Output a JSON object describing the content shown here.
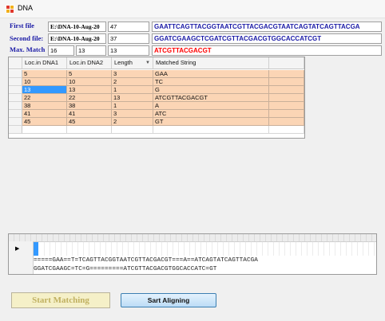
{
  "window": {
    "title": "DNA"
  },
  "inputs": {
    "first_label": "First file",
    "second_label": "Second file:",
    "max_label": "Max. Match",
    "first_path": "E:\\DNA-10-Aug-20",
    "second_path": "E:\\DNA-10-Aug-20",
    "first_length": "47",
    "second_length": "37",
    "first_sequence": "GAATTCAGTTACGGTAATCGTTACGACGTAATCAGTATCAGTTACGA",
    "second_sequence": "GGATCGAAGCTCGATCGTTACGACGTGGCACCATCGT",
    "max_a": "16",
    "max_b": "13",
    "max_c": "13",
    "max_match_string": "ATCGTTACGACGT"
  },
  "grid": {
    "columns": [
      "Loc.in DNA1",
      "Loc.in DNA2",
      "Length",
      "Matched String"
    ],
    "rows": [
      [
        "5",
        "5",
        "3",
        "GAA"
      ],
      [
        "10",
        "10",
        "2",
        "TC"
      ],
      [
        "13",
        "13",
        "1",
        "G"
      ],
      [
        "22",
        "22",
        "13",
        "ATCGTTACGACGT"
      ],
      [
        "38",
        "38",
        "1",
        "A"
      ],
      [
        "41",
        "41",
        "3",
        "ATC"
      ],
      [
        "45",
        "45",
        "2",
        "GT"
      ]
    ]
  },
  "alignment": {
    "row1": "=====GAA==T=TCAGTTACGGTAATCGTTACGACGT===A==ATCAGTATCAGTTACGA",
    "row2": "GGATCGAAGC=TC=G=========ATCGTTACGACGTGGCACCATC=GT"
  },
  "buttons": {
    "start_matching": "Start Matching",
    "start_aligning": "Sart Aligning"
  },
  "colors": {
    "row_fill": "#fbd5b5",
    "selection": "#3399ff",
    "max_match_text": "#ff0000",
    "sequence_text": "#1a1aa6",
    "label_text": "#1a1aa6"
  }
}
